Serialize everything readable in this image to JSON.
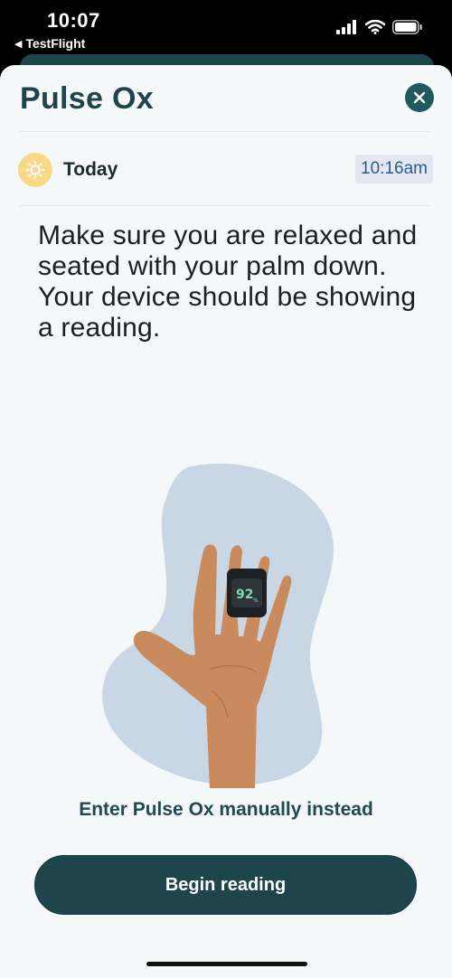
{
  "status_bar": {
    "time": "10:07",
    "back_app": "TestFlight",
    "icons": [
      "cellular-signal-icon",
      "wifi-icon",
      "battery-icon"
    ]
  },
  "header": {
    "title": "Pulse Ox",
    "close_icon": "close-icon"
  },
  "entry": {
    "day_icon": "sun-icon",
    "day_label": "Today",
    "time": "10:16am"
  },
  "instructions": "Make sure you are relaxed and seated with your palm down. Your device should be showing a reading.",
  "illustration": {
    "oximeter_reading": "92",
    "oximeter_unit": "%"
  },
  "actions": {
    "manual_link": "Enter Pulse Ox manually instead",
    "begin_button": "Begin reading"
  },
  "colors": {
    "primary": "#1f454c",
    "sheet_background": "#f4f8f8",
    "sun_badge": "#f8d98a",
    "time_badge_text": "#2c5b8b",
    "time_badge_background": "#e3e8ee",
    "illustration_blob": "#c9d6e4",
    "skin": "#c98a5e",
    "reading_green": "#7fd9b0"
  }
}
